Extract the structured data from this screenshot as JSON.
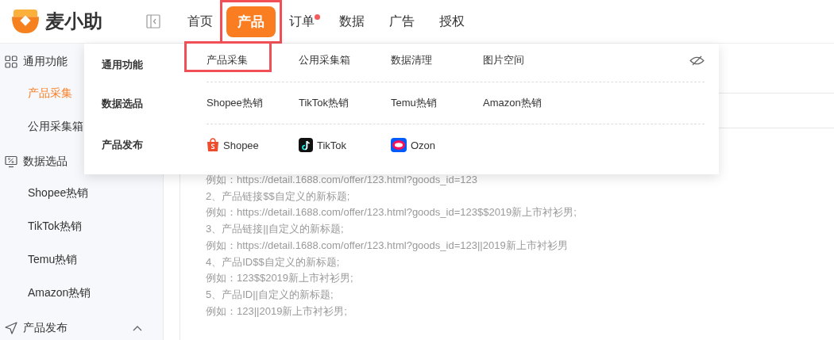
{
  "header": {
    "brand": "麦小助",
    "nav": [
      {
        "label": "首页",
        "selected": false,
        "highlighted": false,
        "dot": false
      },
      {
        "label": "产品",
        "selected": true,
        "highlighted": true,
        "dot": false
      },
      {
        "label": "订单",
        "selected": false,
        "highlighted": false,
        "dot": true
      },
      {
        "label": "数据",
        "selected": false,
        "highlighted": false,
        "dot": false
      },
      {
        "label": "广告",
        "selected": false,
        "highlighted": false,
        "dot": false
      },
      {
        "label": "授权",
        "selected": false,
        "highlighted": false,
        "dot": false
      }
    ]
  },
  "sidebar": {
    "groups": [
      {
        "label": "通用功能",
        "children": [
          {
            "label": "产品采集",
            "selected": true
          },
          {
            "label": "公用采集箱",
            "selected": false
          }
        ]
      },
      {
        "label": "数据选品",
        "children": [
          {
            "label": "Shopee热销",
            "selected": false
          },
          {
            "label": "TikTok热销",
            "selected": false
          },
          {
            "label": "Temu热销",
            "selected": false
          },
          {
            "label": "Amazon热销",
            "selected": false
          }
        ]
      },
      {
        "label": "产品发布",
        "expanded": true
      }
    ]
  },
  "dropdown": {
    "rows": [
      {
        "label": "通用功能",
        "items": [
          {
            "label": "产品采集",
            "highlighted": true
          },
          {
            "label": "公用采集箱",
            "highlighted": false
          },
          {
            "label": "数据清理",
            "highlighted": false
          },
          {
            "label": "图片空间",
            "highlighted": false
          }
        ]
      },
      {
        "label": "数据选品",
        "items": [
          {
            "label": "Shopee热销",
            "highlighted": false
          },
          {
            "label": "TikTok热销",
            "highlighted": false
          },
          {
            "label": "Temu热销",
            "highlighted": false
          },
          {
            "label": "Amazon热销",
            "highlighted": false
          }
        ]
      },
      {
        "label": "产品发布",
        "items": [
          {
            "label": "Shopee",
            "highlighted": false
          },
          {
            "label": "TikTok",
            "highlighted": false
          },
          {
            "label": "Ozon",
            "highlighted": false
          }
        ]
      }
    ]
  },
  "content": {
    "lines": [
      "例如：https://detail.1688.com/offer/123.html?goods_id=123",
      "2、产品链接$$自定义的新标题;",
      "例如：https://detail.1688.com/offer/123.html?goods_id=123$$2019新上市衬衫男;",
      "3、产品链接||自定义的新标题;",
      "例如：https://detail.1688.com/offer/123.html?goods_id=123||2019新上市衬衫男",
      "4、产品ID$$自定义的新标题;",
      "例如：123$$2019新上市衬衫男;",
      "5、产品ID||自定义的新标题;",
      "例如：123||2019新上市衬衫男;"
    ]
  }
}
